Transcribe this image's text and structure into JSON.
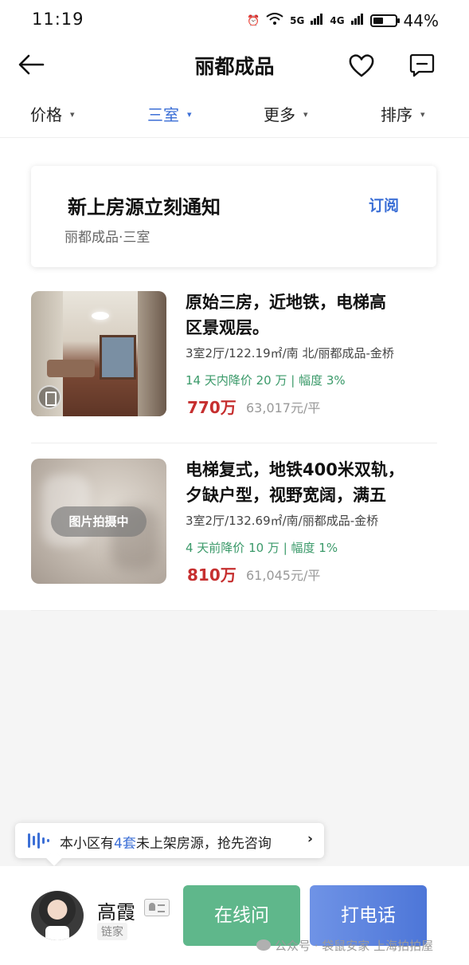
{
  "status_bar": {
    "time": "11:19",
    "network_1": "5G",
    "network_2": "4G",
    "battery": "44%"
  },
  "header": {
    "title": "丽都成品"
  },
  "filters": [
    {
      "label": "价格",
      "active": false
    },
    {
      "label": "三室",
      "active": true
    },
    {
      "label": "更多",
      "active": false
    },
    {
      "label": "排序",
      "active": false
    }
  ],
  "notify": {
    "title": "新上房源立刻通知",
    "subtitle": "丽都成品·三室",
    "action": "订阅"
  },
  "listings": [
    {
      "title": "原始三房，近地铁，电梯高\n区景观层。",
      "meta": "3室2厅/122.19㎡/南 北/丽都成品-金桥",
      "drop": "14 天内降价 20 万 | 幅度 3%",
      "price": "770万",
      "unit_price": "63,017元/平"
    },
    {
      "title": "电梯复式，地铁400米双轨，\n夕缺户型，视野宽阔，满五",
      "meta": "3室2厅/132.69㎡/南/丽都成品-金桥",
      "drop": "4 天前降价 10 万 | 幅度 1%",
      "price": "810万",
      "unit_price": "61,045元/平",
      "photo_badge": "图片拍摄中"
    }
  ],
  "consult": {
    "prefix": "本小区有",
    "count": "4套",
    "suffix": "未上架房源，抢先咨询",
    "arrow": "›"
  },
  "agent": {
    "name": "高霞",
    "company": "链家"
  },
  "actions": {
    "online": "在线问",
    "call": "打电话"
  },
  "watermark": "公众号 · 袋鼠安家 上海拍拍屋",
  "colors": {
    "accent": "#3c6fd6",
    "price": "#c62f2f",
    "drop": "#3b9a6a",
    "online_btn": "#5fb78b",
    "call_btn": "#4d76d8"
  }
}
